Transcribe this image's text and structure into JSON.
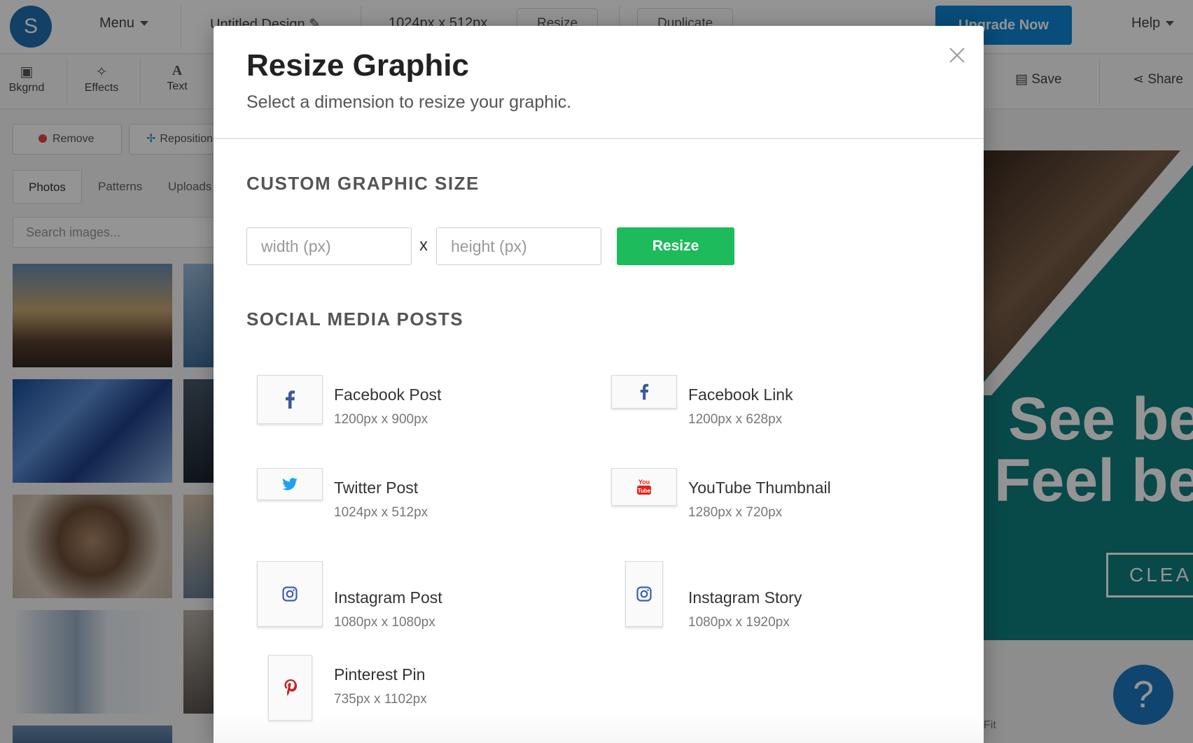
{
  "app": {
    "logo_letter": "S",
    "menu_label": "Menu",
    "design_name": "Untitled Design",
    "design_size": "1024px x 512px",
    "resize_label": "Resize",
    "duplicate_label": "Duplicate",
    "upgrade_label": "Upgrade Now",
    "help_label": "Help",
    "accent_color": "#0e86d4"
  },
  "toolbar": {
    "bkgrnd_label": "Bkgrnd",
    "effects_label": "Effects",
    "text_label": "Text",
    "save_label": "Save",
    "share_label": "Share"
  },
  "sidebar": {
    "remove_label": "Remove",
    "reposition_label": "Reposition",
    "tabs": [
      "Photos",
      "Patterns",
      "Uploads"
    ],
    "search_placeholder": "Search images..."
  },
  "canvas": {
    "headline_line1": "See be",
    "headline_line2": "Feel be",
    "button_text": "CLEA",
    "fit_label": "Fit",
    "help_icon": "?",
    "teal_color": "#0e7e7e"
  },
  "modal": {
    "title": "Resize Graphic",
    "subtitle": "Select a dimension to resize your graphic.",
    "custom_section_title": "CUSTOM GRAPHIC SIZE",
    "width_placeholder": "width (px)",
    "height_placeholder": "height (px)",
    "times_symbol": "x",
    "resize_button": "Resize",
    "resize_color": "#1dbb5b",
    "social_section_title": "SOCIAL MEDIA POSTS",
    "presets": [
      {
        "name": "Facebook Post",
        "size": "1200px x 900px",
        "icon": "facebook-icon"
      },
      {
        "name": "Facebook Link",
        "size": "1200px x 628px",
        "icon": "facebook-icon"
      },
      {
        "name": "Twitter Post",
        "size": "1024px x 512px",
        "icon": "twitter-icon"
      },
      {
        "name": "YouTube Thumbnail",
        "size": "1280px x 720px",
        "icon": "youtube-icon"
      },
      {
        "name": "Instagram Post",
        "size": "1080px x 1080px",
        "icon": "instagram-icon"
      },
      {
        "name": "Instagram Story",
        "size": "1080px x 1920px",
        "icon": "instagram-icon"
      },
      {
        "name": "Pinterest Pin",
        "size": "735px x 1102px",
        "icon": "pinterest-icon"
      }
    ]
  }
}
